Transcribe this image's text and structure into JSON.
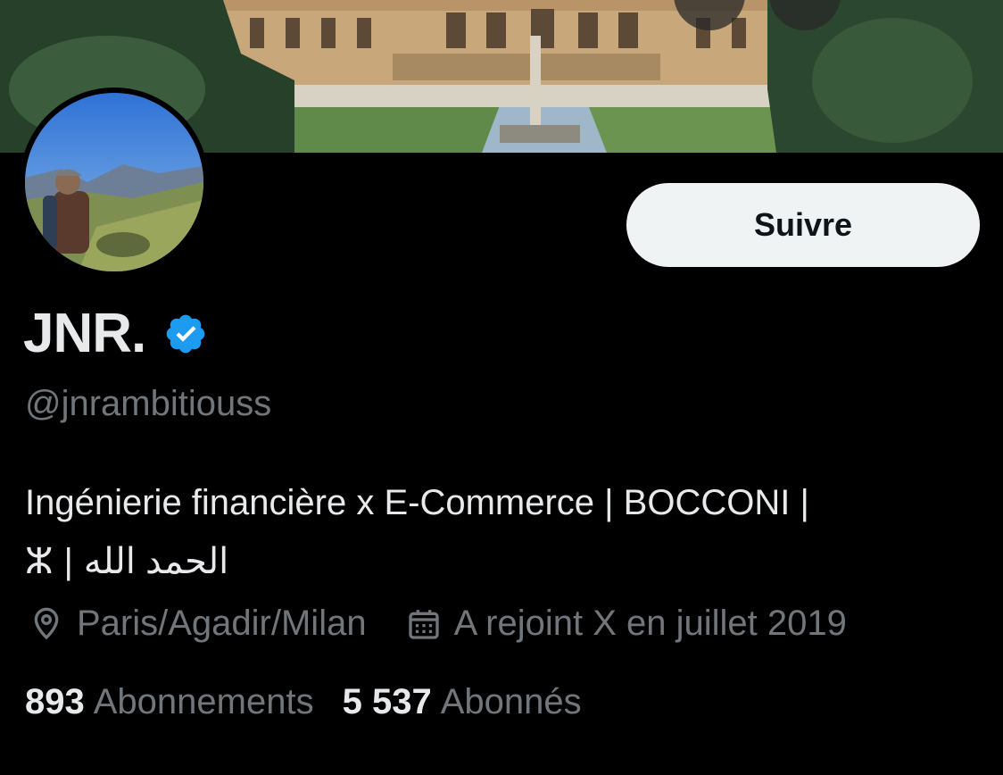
{
  "profile": {
    "display_name": "JNR.",
    "handle": "@jnrambitiouss",
    "verified": true,
    "follow_label": "Suivre",
    "bio_line1": "Ingénierie financière x E-Commerce | BOCCONI |",
    "bio_line2_symbol": "ⵣ",
    "bio_line2_separator": "|",
    "bio_line2_arabic": "الحمد الله",
    "location": "Paris/Agadir/Milan",
    "joined": "A rejoint X en juillet 2019",
    "following_count": "893",
    "following_label": "Abonnements",
    "followers_count": "5 537",
    "followers_label": "Abonnés"
  },
  "icons": {
    "verified": "verified-badge-icon",
    "location": "location-pin-icon",
    "calendar": "calendar-icon"
  },
  "colors": {
    "background": "#000000",
    "primary_text": "#e7e9ea",
    "secondary_text": "#71767b",
    "verified_blue": "#1d9bf0",
    "follow_button_bg": "#eff3f4",
    "follow_button_text": "#0f1419"
  }
}
